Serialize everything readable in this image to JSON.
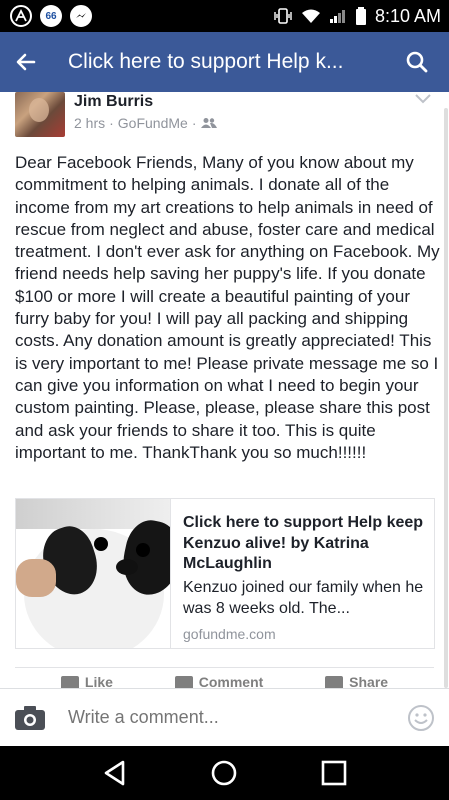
{
  "status_bar": {
    "notification_badge": "66",
    "time": "8:10 AM"
  },
  "app_bar": {
    "title": "Click here to support Help k..."
  },
  "post": {
    "author": "Jim Burris",
    "meta_time": "2 hrs",
    "meta_app": "GoFundMe",
    "body": "Dear Facebook Friends, Many of you know about my commitment to helping animals. I donate all of the income from my art creations to help animals in need of rescue from neglect and abuse, foster care and medical treatment. I don't ever ask for anything on Facebook. My friend needs help saving her puppy's life. If you donate $100 or more I will create a beautiful painting of your furry baby for you! I will pay all packing and shipping costs. Any donation amount is greatly appreciated! This is very important to me! Please private message me so I can give you information on what I need to begin your custom painting. Please, please, please share this post and ask your friends to share it too. This is quite important to me. ThankThank you so much!!!!!!",
    "link_card": {
      "title": "Click here to support Help keep Kenzuo alive! by Katrina McLaughlin",
      "description": "Kenzuo joined our family when he was 8 weeks old. The...",
      "domain": "gofundme.com"
    },
    "actions": {
      "like": "Like",
      "comment": "Comment",
      "share": "Share"
    }
  },
  "comment_bar": {
    "placeholder": "Write a comment..."
  },
  "colors": {
    "brand_blue": "#3b5998",
    "meta_gray": "#90949c"
  }
}
